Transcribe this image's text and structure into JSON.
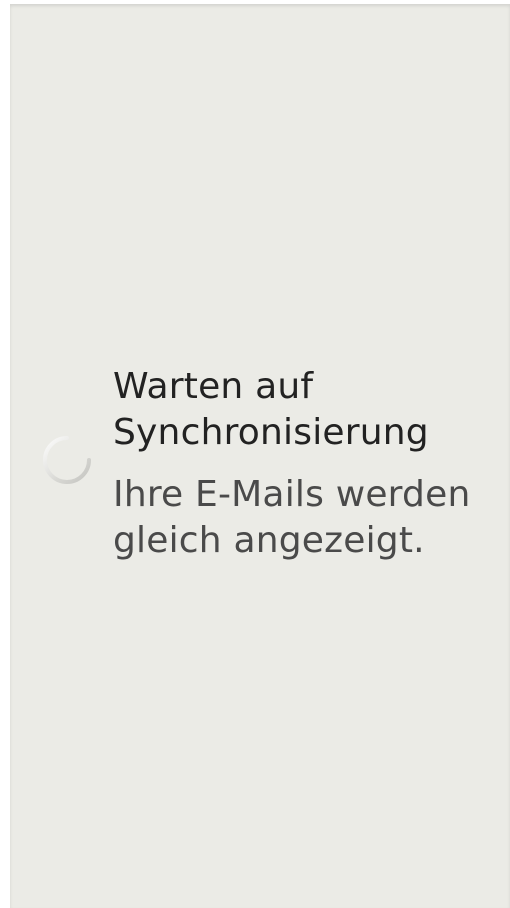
{
  "sync": {
    "title": "Warten auf Synchronisierung",
    "message": "Ihre E-Mails werden gleich angezeigt.",
    "spinner_icon": "loading-spinner-icon"
  },
  "colors": {
    "background": "#ebebe6",
    "title_text": "#222222",
    "message_text": "#4a4a4a",
    "spinner": "#d0d0cc"
  }
}
